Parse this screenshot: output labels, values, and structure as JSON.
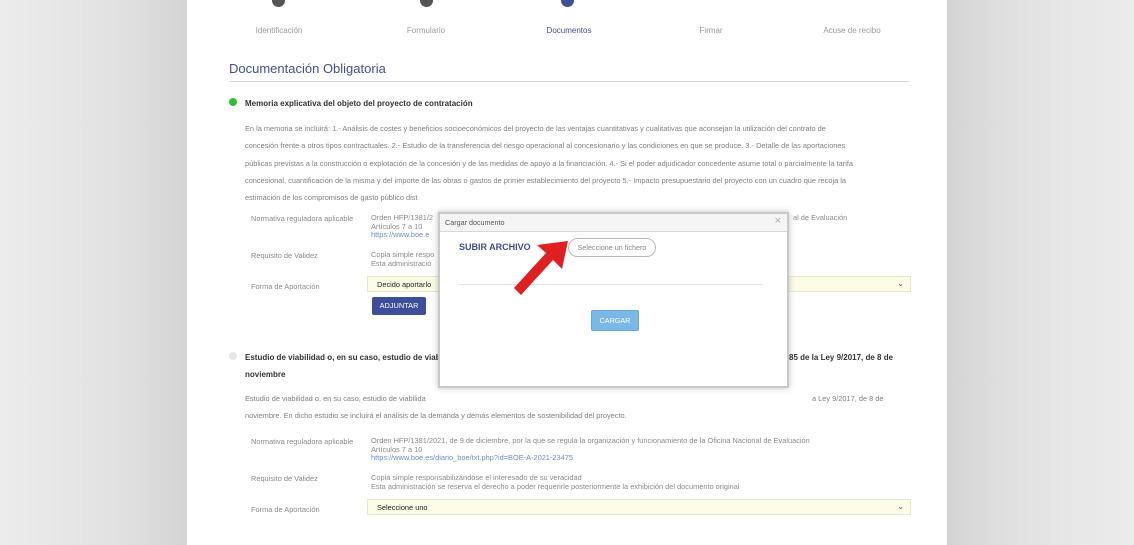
{
  "stepper": {
    "steps": [
      "Identificación",
      "Formulario",
      "Documentos",
      "Firmar",
      "Acuse de recibo"
    ],
    "active": "Documentos"
  },
  "page_title": "Documentación Obligatoria",
  "section1": {
    "title": "Memoria explicativa del objeto del proyecto de contratación",
    "lines": [
      "En la memoria se incluirá: 1.- Análisis de costes y beneficios socioeconómicos del proyecto de las ventajas cuantitativas y cualitativas que aconsejan la utilización del contrato de",
      "concesión frente a otros tipos contractuales. 2.- Estudio de la transferencia del riesgo operacional al concesionario y las condiciones en que se produce. 3.- Detalle de las aportaciones",
      "públicas previstas a la construcción o explotación de la concesión y de las medidas de apoyo a la financiación. 4.- Si el poder adjudicador concedente asume total o parcialmente la tarifa",
      "concesional, cuantificación de la misma y del importe de las obras o gastos de primer establecimiento del proyecto 5.- Impacto presupuestario del proyecto con un cuadro que recoja la",
      "estimación de los compromisos de gasto público dist"
    ],
    "normativa_label": "Normativa reguladora aplicable",
    "normativa_lines": [
      "Orden HFP/1381/2",
      "Artículos 7 a 10",
      "https://www.boe.e"
    ],
    "normativa_tail": "al de Evaluación",
    "requisito_label": "Requisito de Validez",
    "requisito_lines": [
      "Copia simple respo",
      "Esta administració"
    ],
    "forma_label": "Forma de Aportación",
    "forma_value": "Decido aportarlo",
    "adjuntar": "ADJUNTAR"
  },
  "section2": {
    "title_line1": "Estudio de viabilidad o, en su caso, estudio de viabi",
    "title_tail": "85 de la Ley 9/2017, de 8 de",
    "title_line2": "noviembre",
    "para_line1_start": "Estudio de viabilidad o, en su caso, estudio de viabilida",
    "para_line1_end": "a Ley 9/2017, de 8 de",
    "para_line2": "noviembre. En dicho estudio se incluirá el análisis de la demanda y demás elementos de sostenibilidad del proyecto.",
    "normativa_label": "Normativa reguladora aplicable",
    "normativa_lines": [
      "Orden HFP/1381/2021, de 9 de diciembre, por la que se regula la organización y funcionamiento de la Oficina Nacional de Evaluación",
      "Artículos 7 a 10",
      "https://www.boe.es/diario_boe/txt.php?id=BOE-A-2021-23475"
    ],
    "requisito_label": "Requisito de Validez",
    "requisito_lines": [
      "Copia simple responsabilizándose el interesado de su veracidad",
      "Esta administración se reserva el derecho a poder requerirle posteriormente la exhibición del documento original"
    ],
    "forma_label": "Forma de Aportación",
    "forma_value": "Seleccione uno"
  },
  "modal": {
    "title": "Cargar documento",
    "close": "×",
    "upload_title": "SUBIR ARCHIVO",
    "file_button": "Seleccione un fichero",
    "submit": "CARGAR"
  },
  "colors": {
    "accent": "#3e4e99",
    "ok": "#2fbf2f",
    "annotation_arrow": "#e02020"
  }
}
